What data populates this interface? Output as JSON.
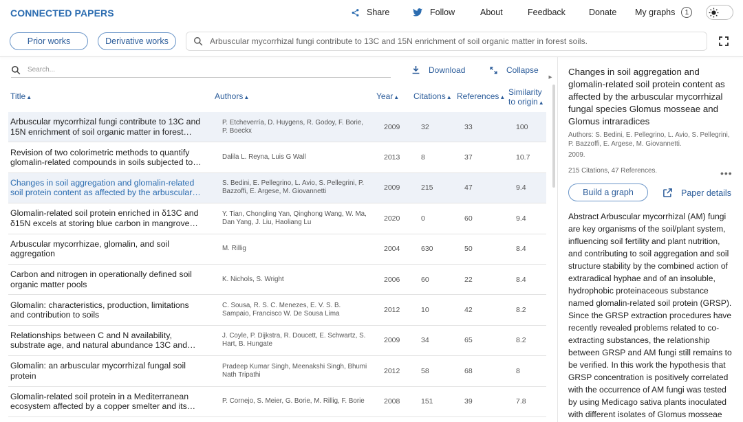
{
  "brand": "CONNECTED PAPERS",
  "nav": {
    "share": "Share",
    "follow": "Follow",
    "about": "About",
    "feedback": "Feedback",
    "donate": "Donate",
    "my_graphs": "My graphs",
    "my_graphs_count": "1"
  },
  "toolbar": {
    "prior_works": "Prior works",
    "derivative_works": "Derivative works",
    "search_query": "Arbuscular mycorrhizal fungi contribute to 13C and 15N enrichment of soil organic matter in forest soils."
  },
  "list": {
    "search_placeholder": "Search...",
    "download": "Download",
    "collapse": "Collapse",
    "columns": {
      "title": "Title",
      "authors": "Authors",
      "year": "Year",
      "citations": "Citations",
      "references": "References",
      "similarity_1": "Similarity",
      "similarity_2": "to origin"
    },
    "rows": [
      {
        "title": "Arbuscular mycorrhizal fungi contribute to 13C and 15N enrichment of soil organic matter in forest…",
        "authors": "P. Etcheverría, D. Huygens, R. Godoy, F. Borie, P. Boeckx",
        "year": "2009",
        "citations": "32",
        "references": "33",
        "similarity": "100"
      },
      {
        "title": "Revision of two colorimetric methods to quantify glomalin-related compounds in soils subjected to…",
        "authors": "Dalila L. Reyna, Luis G Wall",
        "year": "2013",
        "citations": "8",
        "references": "37",
        "similarity": "10.7"
      },
      {
        "title": "Changes in soil aggregation and glomalin-related soil protein content as affected by the arbuscular…",
        "authors": "S. Bedini, E. Pellegrino, L. Avio, S. Pellegrini, P. Bazzoffi, E. Argese, M. Giovannetti",
        "year": "2009",
        "citations": "215",
        "references": "47",
        "similarity": "9.4"
      },
      {
        "title": "Glomalin-related soil protein enriched in δ13C and δ15N excels at storing blue carbon in mangrove…",
        "authors": "Y. Tian, Chongling Yan, Qinghong Wang, W. Ma, Dan Yang, J. Liu, Haoliang Lu",
        "year": "2020",
        "citations": "0",
        "references": "60",
        "similarity": "9.4"
      },
      {
        "title": "Arbuscular mycorrhizae, glomalin, and soil aggregation",
        "authors": "M. Rillig",
        "year": "2004",
        "citations": "630",
        "references": "50",
        "similarity": "8.4"
      },
      {
        "title": "Carbon and nitrogen in operationally defined soil organic matter pools",
        "authors": "K. Nichols, S. Wright",
        "year": "2006",
        "citations": "60",
        "references": "22",
        "similarity": "8.4"
      },
      {
        "title": "Glomalin: characteristics, production, limitations and contribution to soils",
        "authors": "C. Sousa, R. S. C. Menezes, E. V. S. B. Sampaio, Francisco W. De Sousa Lima",
        "year": "2012",
        "citations": "10",
        "references": "42",
        "similarity": "8.2"
      },
      {
        "title": "Relationships between C and N availability, substrate age, and natural abundance 13C and 15…",
        "authors": "J. Coyle, P. Dijkstra, R. Doucett, E. Schwartz, S. Hart, B. Hungate",
        "year": "2009",
        "citations": "34",
        "references": "65",
        "similarity": "8.2"
      },
      {
        "title": "Glomalin: an arbuscular mycorrhizal fungal soil protein",
        "authors": "Pradeep Kumar Singh, Meenakshi Singh, Bhumi Nath Tripathi",
        "year": "2012",
        "citations": "58",
        "references": "68",
        "similarity": "8"
      },
      {
        "title": "Glomalin-related soil protein in a Mediterranean ecosystem affected by a copper smelter and its…",
        "authors": "P. Cornejo, S. Meier, G. Borie, M. Rillig, F. Borie",
        "year": "2008",
        "citations": "151",
        "references": "39",
        "similarity": "7.8"
      }
    ]
  },
  "detail": {
    "title": "Changes in soil aggregation and glomalin-related soil protein content as affected by the arbuscular mycorrhizal fungal species Glomus mosseae and Glomus intraradices",
    "authors": "Authors: S. Bedini, E. Pellegrino, L. Avio, S. Pellegrini, P. Bazzoffi, E. Argese, M. Giovannetti.",
    "year": "2009.",
    "counts": "215 Citations, 47 References.",
    "build_graph": "Build a graph",
    "paper_details": "Paper details",
    "abstract": "Abstract Arbuscular mycorrhizal (AM) fungi are key organisms of the soil/plant system, influencing soil fertility and plant nutrition, and contributing to soil aggregation and soil structure stability by the combined action of extraradical hyphae and of an insoluble, hydrophobic proteinaceous substance named glomalin-related soil protein (GRSP). Since the GRSP extraction procedures have recently revealed problems related to co-extracting substances, the relationship between GRSP and AM fungi still remains to be verified. In this work the hypothesis that GRSP concentration is positively correlated with the occurrence of AM fungi was tested by using Medicago sativa plants inoculated with different isolates of Glomus mosseae"
  },
  "colors": {
    "accent": "#2b6cb0",
    "selected_row": "#eef2f8"
  }
}
